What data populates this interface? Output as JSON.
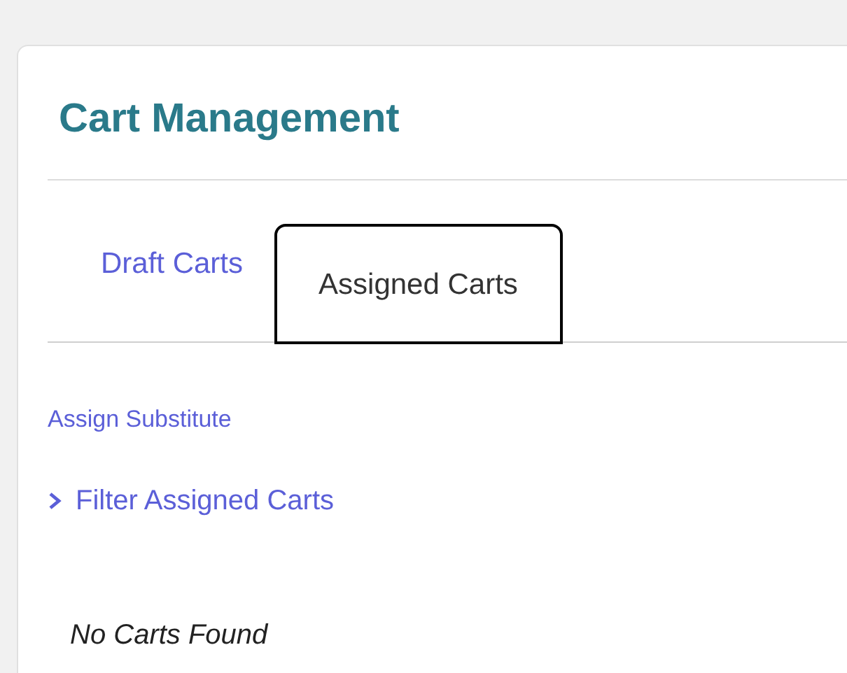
{
  "title": "Cart Management",
  "tabs": [
    {
      "label": "Draft Carts",
      "selected": false
    },
    {
      "label": "Assigned Carts",
      "selected": true
    }
  ],
  "assign_link": "Assign Substitute",
  "filter": {
    "label": "Filter Assigned Carts",
    "expanded": false
  },
  "empty_message": "No Carts Found"
}
